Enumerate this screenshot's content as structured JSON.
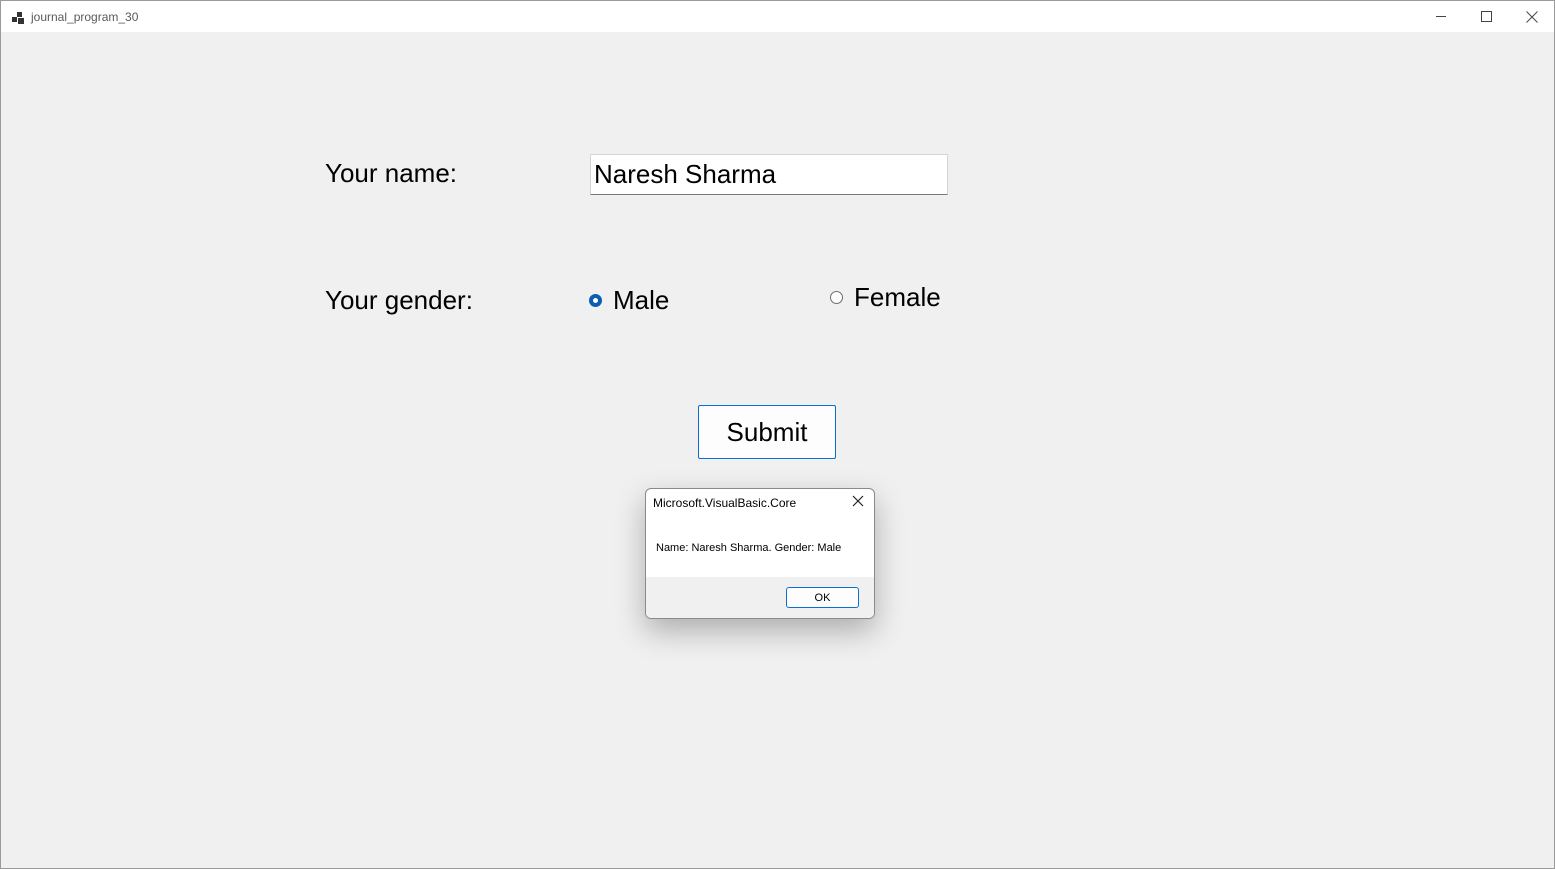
{
  "window": {
    "title": "journal_program_30",
    "icon": "app-icon",
    "controls": [
      "minimize-icon",
      "maximize-icon",
      "close-icon"
    ]
  },
  "form": {
    "name_label": "Your name:",
    "name_value": "Naresh Sharma",
    "gender_label": "Your gender:",
    "gender_options": [
      {
        "label": "Male",
        "checked": true
      },
      {
        "label": "Female",
        "checked": false
      }
    ],
    "submit_label": "Submit"
  },
  "dialog": {
    "title": "Microsoft.VisualBasic.Core",
    "message": "Name: Naresh Sharma. Gender: Male",
    "ok_label": "OK",
    "close_icon": "close-icon"
  },
  "colors": {
    "accent": "#0a5fb4",
    "background": "#f0f0f0",
    "titlebar": "#ffffff"
  }
}
